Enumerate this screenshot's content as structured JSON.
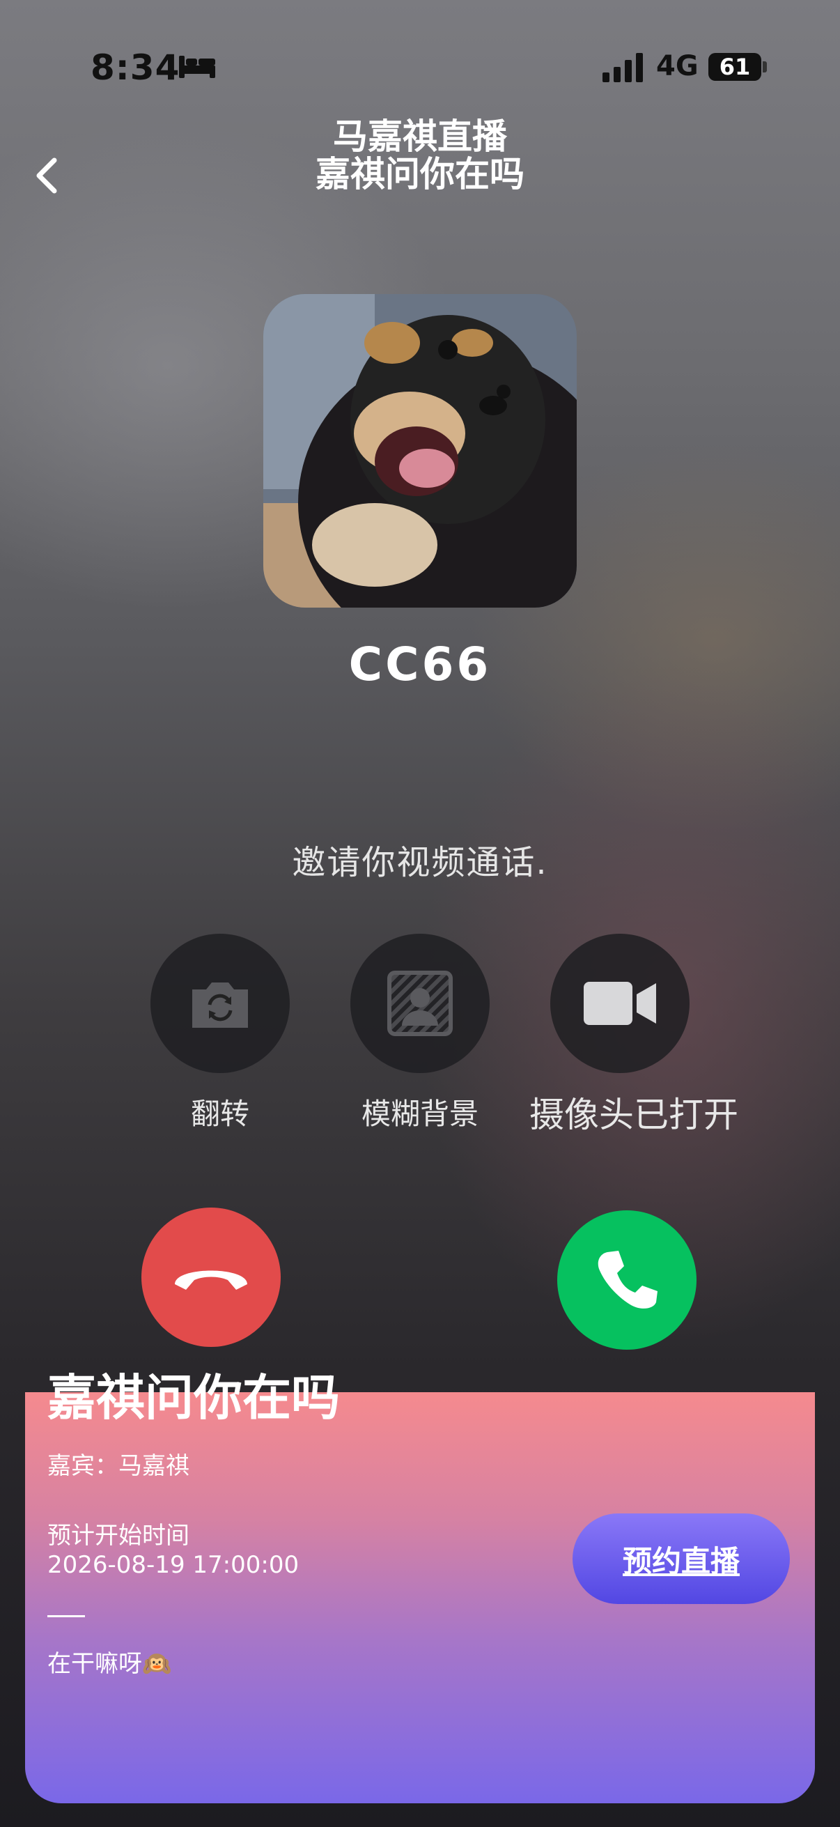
{
  "status_bar": {
    "time": "8:34",
    "network": "4G",
    "battery": "61"
  },
  "header": {
    "title": "马嘉祺直播",
    "subtitle": "嘉祺问你在吗"
  },
  "caller": {
    "name": "CC66",
    "avatar": "shiba-puppy-photo"
  },
  "invite_text": "邀请你视频通话.",
  "controls": [
    {
      "label": "翻转",
      "icon": "camera-flip-icon"
    },
    {
      "label": "模糊背景",
      "icon": "blur-background-icon"
    },
    {
      "label": "摄像头已打开",
      "icon": "video-camera-icon"
    }
  ],
  "call_buttons": {
    "decline_color": "#e24b4b",
    "accept_color": "#06c15f"
  },
  "card": {
    "title": "嘉祺问你在吗",
    "guest": "嘉宾：马嘉祺",
    "start_label": "预计开始时间",
    "start_time": "2026-08-19 17:00:00",
    "divider": "——",
    "note": "在干嘛呀🙉",
    "reserve_button": "预约直播"
  }
}
